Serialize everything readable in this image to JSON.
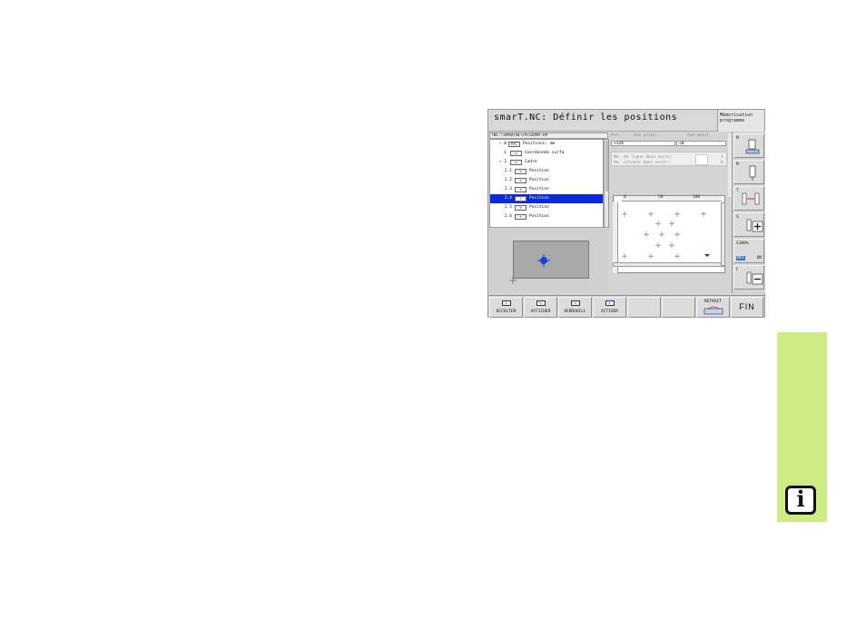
{
  "window": {
    "title": "smarT.NC: Définir les positions",
    "mode": "Mémorisation\nprogramme"
  },
  "tree": {
    "path": "TNC:\\SMARTNC\\PATDUMP.HP",
    "rows": [
      {
        "num": "▿ 0",
        "icon": "PAT",
        "label": "Positions: mm",
        "selected": false
      },
      {
        "num": "1",
        "icon": "▭",
        "label": "Coordonnée surfa",
        "selected": false
      },
      {
        "num": "▿ 2",
        "icon": "▭",
        "label": "Cadre",
        "selected": false
      },
      {
        "num": "2.1",
        "icon": "+",
        "label": "Position",
        "selected": false
      },
      {
        "num": "2.2",
        "icon": "+",
        "label": "Position",
        "selected": false
      },
      {
        "num": "2.3",
        "icon": "+",
        "label": "Position",
        "selected": false
      },
      {
        "num": "2.4",
        "icon": "+",
        "label": "Position",
        "selected": true
      },
      {
        "num": "2.5",
        "icon": "+",
        "label": "Position",
        "selected": false
      },
      {
        "num": "2.6",
        "icon": "+",
        "label": "Position",
        "selected": false
      }
    ]
  },
  "form": {
    "headers": [
      "Pos.",
      "Axe princ.",
      "Axe auxil."
    ],
    "values": [
      "+120",
      "+0"
    ],
    "info_lines": [
      "No. de ligne dans exctr:",
      "No. colonne dans exctr:"
    ],
    "info_values": [
      "1",
      "0"
    ]
  },
  "plot": {
    "ruler_labels": [
      "0",
      "50",
      "100"
    ],
    "marker_count": 18
  },
  "vkeys": [
    {
      "name": "m-key",
      "top": "M",
      "bottom": ""
    },
    {
      "name": "m2-key",
      "top": "M",
      "bottom": ""
    },
    {
      "name": "t-key",
      "top": "T",
      "bottom": ""
    },
    {
      "name": "s-key",
      "top": "S",
      "bottom": ""
    },
    {
      "name": "s100-key",
      "top": "S100%",
      "bottom": "ON",
      "extra": "OFF"
    },
    {
      "name": "f-key",
      "top": "F",
      "bottom": ""
    }
  ],
  "hkeys": [
    {
      "name": "occulter-button",
      "label": "OCCULTER"
    },
    {
      "name": "afficher-button",
      "label": "AFFICHER"
    },
    {
      "name": "verrouill-button",
      "label": "VERROUILL"
    },
    {
      "name": "activer-button",
      "label": "ACTIVER"
    },
    {
      "name": "empty-button-1",
      "label": ""
    },
    {
      "name": "empty-button-2",
      "label": ""
    },
    {
      "name": "retrait-button",
      "label": "RETRAIT"
    },
    {
      "name": "fin-button",
      "label": "FIN"
    }
  ],
  "side": {
    "info_glyph": "i"
  },
  "colors": {
    "selection": "#0a2ad8",
    "side_tab": "#cdec84",
    "marker": "#7a7a7a"
  }
}
